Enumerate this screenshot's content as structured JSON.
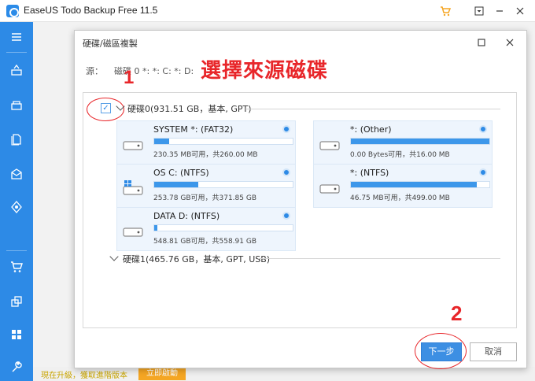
{
  "app": {
    "title": "EaseUS Todo Backup Free 11.5",
    "bottom_text": "現在升級，獲取進階版本",
    "bottom_button": "立即啟動"
  },
  "dialog": {
    "title": "硬碟/磁區複製",
    "source_label": "源：",
    "source_value": "磁碟 0 *: *: C: *: D:",
    "heading": "選擇來源磁碟",
    "marker_1": "1",
    "marker_2": "2",
    "disk0": {
      "label": "硬碟0(931.51 GB，基本, GPT)",
      "checked_mark": "✓",
      "partitions": [
        {
          "name": "SYSTEM *: (FAT32)",
          "info": "230.35 MB可用，共260.00 MB",
          "used": 0.11,
          "os": false
        },
        {
          "name": "*: (Other)",
          "info": "0.00 Bytes可用，共16.00 MB",
          "used": 1.0,
          "os": false
        },
        {
          "name": "OS C: (NTFS)",
          "info": "253.78 GB可用，共371.85 GB",
          "used": 0.32,
          "os": true
        },
        {
          "name": "*: (NTFS)",
          "info": "46.75 MB可用，共499.00 MB",
          "used": 0.91,
          "os": false
        },
        {
          "name": "DATA D: (NTFS)",
          "info": "548.81 GB可用，共558.91 GB",
          "used": 0.02,
          "os": false
        }
      ]
    },
    "disk1": {
      "label": "硬碟1(465.76 GB，基本, GPT, USB)"
    },
    "next_label": "下一步",
    "cancel_label": "取消"
  },
  "colors": {
    "accent": "#2d8ae6",
    "annotation_red": "#e8262a",
    "card_bg": "#eef5fd",
    "bar_fill": "#3d97ea"
  }
}
